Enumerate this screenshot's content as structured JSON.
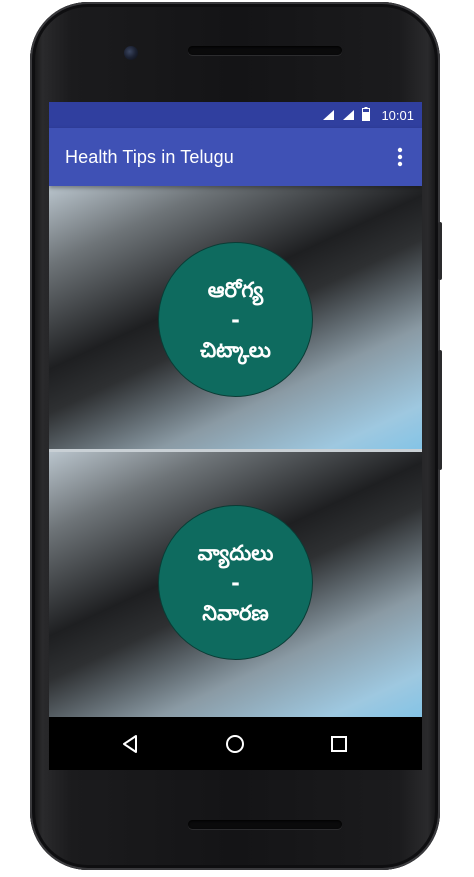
{
  "status_bar": {
    "time": "10:01",
    "icons": [
      "wifi-icon",
      "cell-signal-icon",
      "battery-icon"
    ]
  },
  "app_bar": {
    "title": "Health Tips in Telugu",
    "menu_icon": "overflow-menu-icon"
  },
  "options": [
    {
      "line1": "ఆరోగ్య",
      "line2": "-",
      "line3": "చిట్కాలు"
    },
    {
      "line1": "వ్యాదులు",
      "line2": "-",
      "line3": "నివారణ"
    }
  ],
  "nav_bar": {
    "icons": [
      "back-icon",
      "home-icon",
      "recents-icon"
    ]
  },
  "colors": {
    "status_bar": "#303f9f",
    "app_bar": "#3f51b5",
    "circle": "#0e6b5f"
  }
}
